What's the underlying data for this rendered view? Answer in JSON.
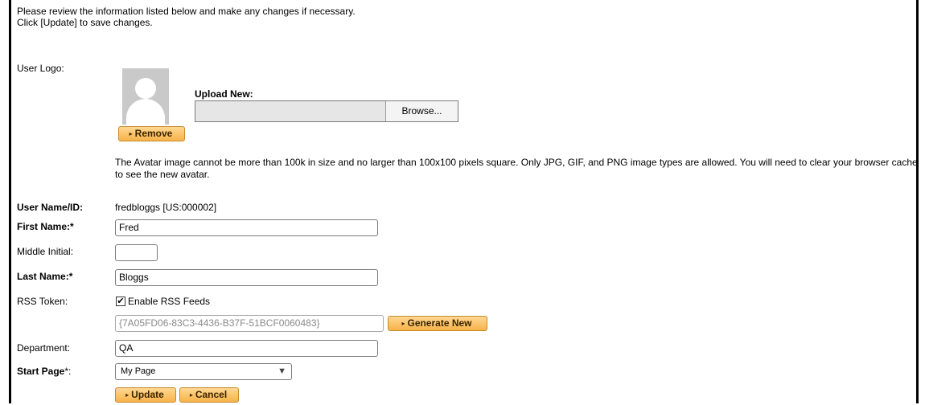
{
  "intro": {
    "line1": "Please review the information listed below and make any changes if necessary.",
    "line2": "Click [Update] to save changes."
  },
  "logo": {
    "label": "User Logo:",
    "upload_label": "Upload New:",
    "browse_label": "Browse...",
    "remove_label": "Remove",
    "note": "The Avatar image cannot be more than 100k in size and no larger than 100x100 pixels square. Only JPG, GIF, and PNG image types are allowed. You will need to clear your browser cache to see the new avatar."
  },
  "user": {
    "id_label": "User Name/ID:",
    "id_value": "fredbloggs [US:000002]",
    "first_label": "First Name:*",
    "first_value": "Fred",
    "middle_label": "Middle Initial:",
    "middle_value": "",
    "last_label": "Last Name:*",
    "last_value": "Bloggs"
  },
  "rss": {
    "label": "RSS Token:",
    "enable_label": "Enable RSS Feeds",
    "enabled": true,
    "check_glyph": "✔",
    "token": "{7A05FD06-83C3-4436-B37F-51BCF0060483}",
    "generate_label": "Generate New"
  },
  "department": {
    "label": "Department:",
    "value": "QA"
  },
  "start_page": {
    "label": "Start Page",
    "suffix": "*:",
    "value": "My Page"
  },
  "actions": {
    "update_label": "Update",
    "cancel_label": "Cancel"
  },
  "icons": {
    "button_marker": "play-triangle-icon",
    "dropdown": "chevron-down-icon",
    "avatar": "user-silhouette-icon"
  },
  "colors": {
    "button_accent": "#f7b34a",
    "button_border": "#c78a2a"
  }
}
